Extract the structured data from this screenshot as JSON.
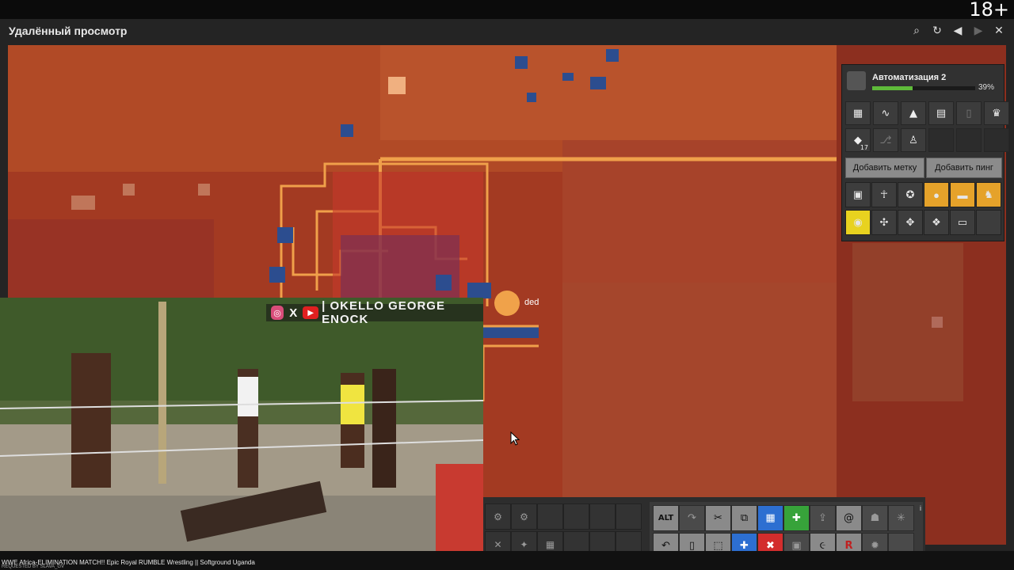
{
  "age_badge": "18+",
  "window": {
    "title": "Удалённый просмотр",
    "controls": [
      "search-icon",
      "refresh-icon",
      "prev-icon",
      "next-icon",
      "close-icon"
    ]
  },
  "map": {
    "player_label": "ded"
  },
  "automation": {
    "title": "Автоматизация 2",
    "progress_percent": 39,
    "progress_text": "39%",
    "row1_icons": [
      "grid-icon",
      "pulse-icon",
      "rocket-icon",
      "book-icon",
      "trash-icon",
      "trophy-icon"
    ],
    "row2_icons": [
      "graduation-icon",
      "network-icon",
      "person-icon"
    ],
    "row2_badge": "17",
    "add_tag_label": "Добавить метку",
    "add_ping_label": "Добавить пинг"
  },
  "video": {
    "overlay_text": "| OKELLO GEORGE ENOCK",
    "caption": "WWE Africa-ELIMINATION MATCH!! Epic Royal RUMBLE Wrestling || Softground Uganda",
    "subcaption": "REQUESTED BY SLAVA_GV"
  },
  "toolbar": {
    "alt_label": "ALT",
    "info_label": "i"
  }
}
